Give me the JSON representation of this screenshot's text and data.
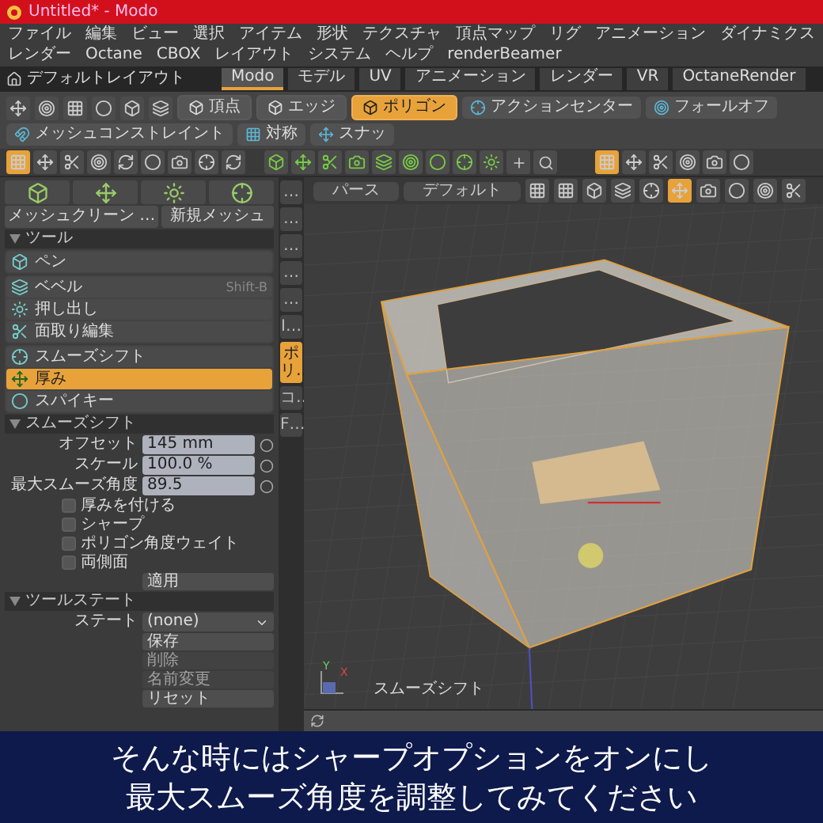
{
  "window": {
    "title": "Untitled* - Modo"
  },
  "menu": [
    "ファイル",
    "編集",
    "ビュー",
    "選択",
    "アイテム",
    "形状",
    "テクスチャ",
    "頂点マップ",
    "リグ",
    "アニメーション",
    "ダイナミクス",
    "レンダー",
    "Octane",
    "CBOX",
    "レイアウト",
    "システム",
    "ヘルプ",
    "renderBeamer"
  ],
  "layout": {
    "name": "デフォルトレイアウト",
    "tabs": [
      {
        "label": "Modo",
        "selected": true
      },
      {
        "label": "モデル",
        "selected": false
      },
      {
        "label": "UV",
        "selected": false
      },
      {
        "label": "アニメーション",
        "selected": false
      },
      {
        "label": "レンダー",
        "selected": false
      },
      {
        "label": "VR",
        "selected": false
      },
      {
        "label": "OctaneRender",
        "selected": false
      }
    ]
  },
  "toolbar": {
    "modes": [
      {
        "label": "頂点",
        "selected": false
      },
      {
        "label": "エッジ",
        "selected": false
      },
      {
        "label": "ポリゴン",
        "selected": true
      }
    ],
    "tools": [
      "アクションセンター",
      "フォールオフ",
      "メッシュコンストレイント",
      "対称",
      "スナッ"
    ]
  },
  "tool_panel": {
    "buttons": [
      "メッシュクリーン …",
      "新規メッシュ"
    ],
    "section": "ツール",
    "groups": [
      [
        {
          "label": "ペン",
          "selected": false
        }
      ],
      [
        {
          "label": "ベベル",
          "shortcut": "Shift-B",
          "selected": false
        },
        {
          "label": "押し出し",
          "selected": false
        },
        {
          "label": "面取り編集",
          "selected": false
        }
      ],
      [
        {
          "label": "スムーズシフト",
          "selected": false
        },
        {
          "label": "厚み",
          "selected": true
        },
        {
          "label": "スパイキー",
          "selected": false
        }
      ]
    ]
  },
  "side_tabs": [
    {
      "label": "…",
      "selected": false
    },
    {
      "label": "…",
      "selected": false
    },
    {
      "label": "…",
      "selected": false
    },
    {
      "label": "…",
      "selected": false
    },
    {
      "label": "…",
      "selected": false
    },
    {
      "label": "I…",
      "selected": false
    },
    {
      "label": "ポリ…",
      "selected": true
    },
    {
      "label": "コ…",
      "selected": false
    },
    {
      "label": "F…",
      "selected": false
    }
  ],
  "properties": {
    "title": "スムーズシフト",
    "fields": [
      {
        "label": "オフセット",
        "value": "145 mm"
      },
      {
        "label": "スケール",
        "value": "100.0 %"
      },
      {
        "label": "最大スムーズ角度",
        "value": "89.5"
      }
    ],
    "options": [
      {
        "label": "厚みを付ける",
        "checked": false
      },
      {
        "label": "シャープ",
        "checked": false
      },
      {
        "label": "ポリゴン角度ウェイト",
        "checked": false
      },
      {
        "label": "両側面",
        "checked": false
      }
    ],
    "apply": "適用"
  },
  "tool_state": {
    "title": "ツールステート",
    "label": "ステート",
    "value": "(none)",
    "buttons": [
      {
        "label": "保存",
        "disabled": false
      },
      {
        "label": "削除",
        "disabled": true
      },
      {
        "label": "名前変更",
        "disabled": true
      },
      {
        "label": "リセット",
        "disabled": false
      }
    ]
  },
  "viewport": {
    "view": "パース",
    "shading": "デフォルト",
    "tool_label": "スムーズシフト",
    "axis_labels": [
      "Y",
      "X"
    ]
  },
  "subtitle": [
    "そんな時にはシャープオプションをオンにし",
    "最大スムーズ角度を調整してみてください"
  ]
}
